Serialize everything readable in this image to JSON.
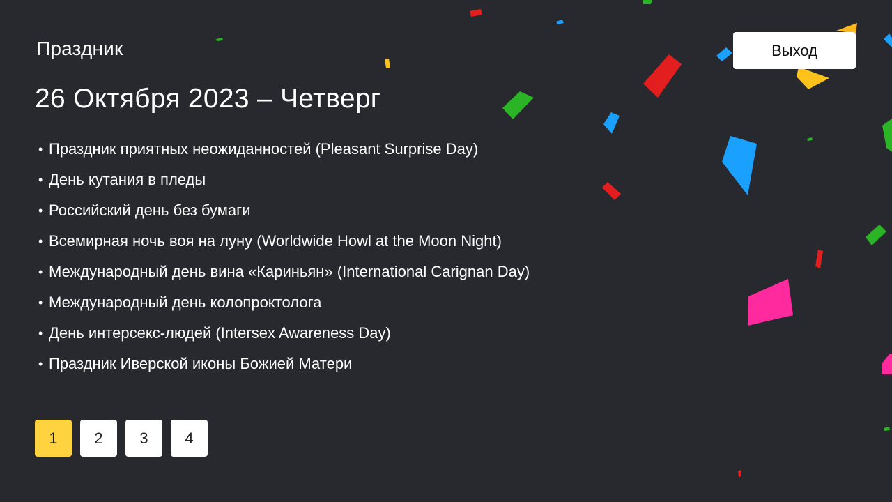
{
  "app": {
    "title": "Праздник",
    "exit_label": "Выход"
  },
  "date_heading": "26 Октября 2023 – Четверг",
  "bullet_symbol": "•",
  "holidays": [
    "Праздник приятных неожиданностей (Pleasant Surprise Day)",
    "День кутания в пледы",
    "Российский день без бумаги",
    "Всемирная ночь воя на луну (Worldwide Howl at the Moon Night)",
    "Международный день вина «Кариньян» (International Carignan Day)",
    "Международный день колопроктолога",
    "День интерсекс-людей (Intersex Awareness Day)",
    "Праздник Иверской иконы Божией Матери"
  ],
  "pagination": {
    "pages": [
      "1",
      "2",
      "3",
      "4"
    ],
    "current": "1"
  },
  "colors": {
    "background": "#27292e",
    "accent": "#ffd33f",
    "button_bg": "#ffffff",
    "confetti": [
      "#e31e1e",
      "#1aa0ff",
      "#2bb526",
      "#ffc21a",
      "#ff2a9d"
    ]
  }
}
